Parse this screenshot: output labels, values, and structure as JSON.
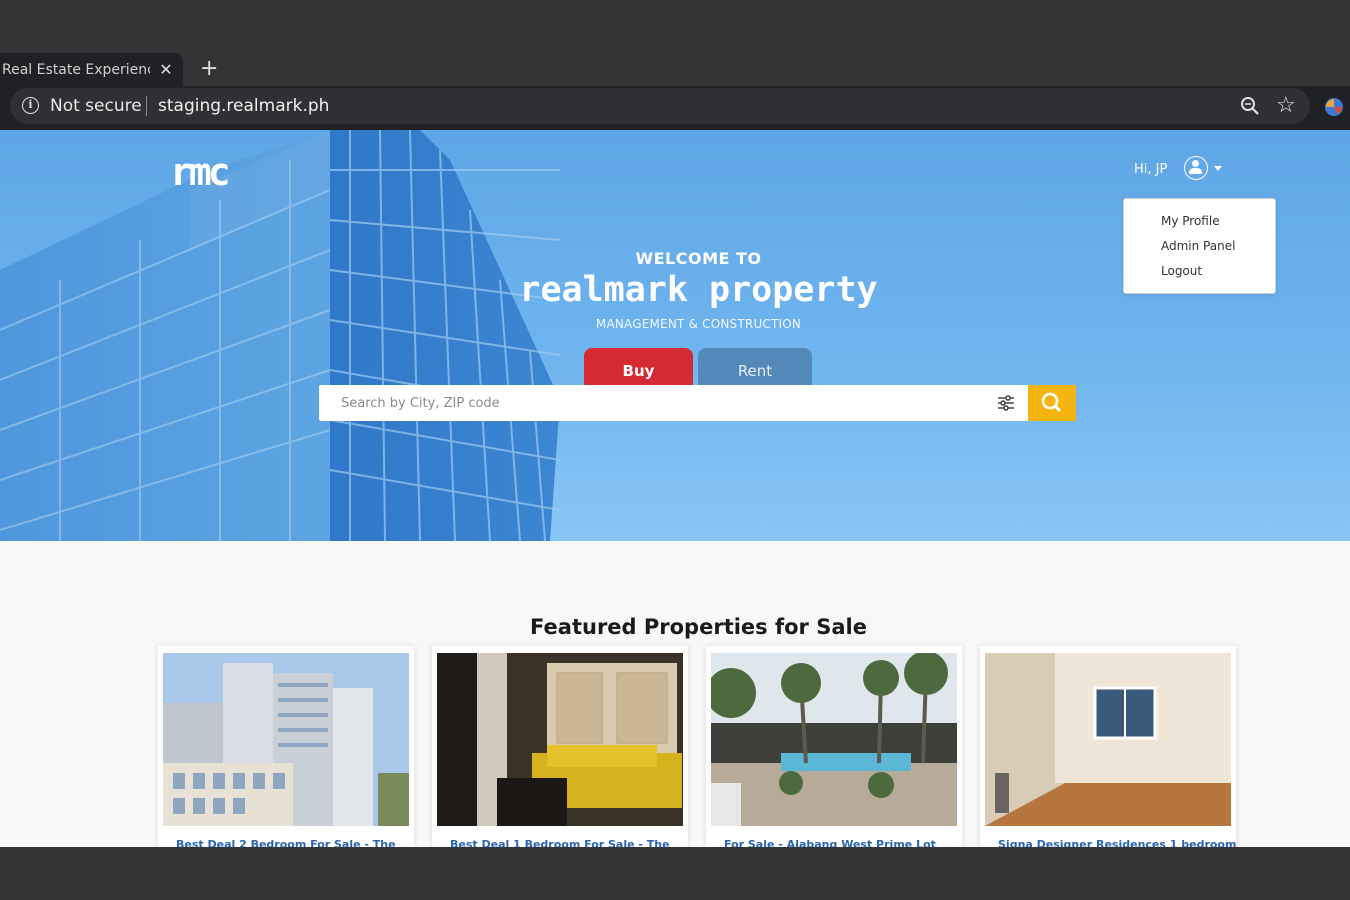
{
  "browser": {
    "tab_title": "Real Estate Experience",
    "tab_close": "✕",
    "new_tab": "+",
    "security_label": "Not secure",
    "url": "staging.realmark.ph",
    "icons": [
      "info-icon",
      "zoom-icon",
      "star-icon",
      "extension-icon"
    ]
  },
  "header": {
    "logo": "rmc",
    "greeting": "Hi, JP",
    "user_menu": [
      "My Profile",
      "Admin Panel",
      "Logout"
    ]
  },
  "hero": {
    "welcome": "WELCOME TO",
    "brand": "realmark property",
    "subtitle": "MANAGEMENT & CONSTRUCTION",
    "tabs": {
      "buy": "Buy",
      "rent": "Rent"
    },
    "search_placeholder": "Search by City, ZIP code"
  },
  "featured": {
    "title": "Featured Properties for Sale",
    "cards": [
      {
        "title": "Best Deal 2 Bedroom For Sale - The"
      },
      {
        "title": "Best Deal 1 Bedroom For Sale - The"
      },
      {
        "title": "For Sale - Alabang West Prime Lot"
      },
      {
        "title": "Signa Designer Residences 1 bedroom"
      }
    ]
  },
  "colors": {
    "buy": "#d52a33",
    "rent": "#5289b8",
    "search_button": "#f5b511",
    "hero_sky": "#6db3ee",
    "card_title": "#2a66b0"
  }
}
